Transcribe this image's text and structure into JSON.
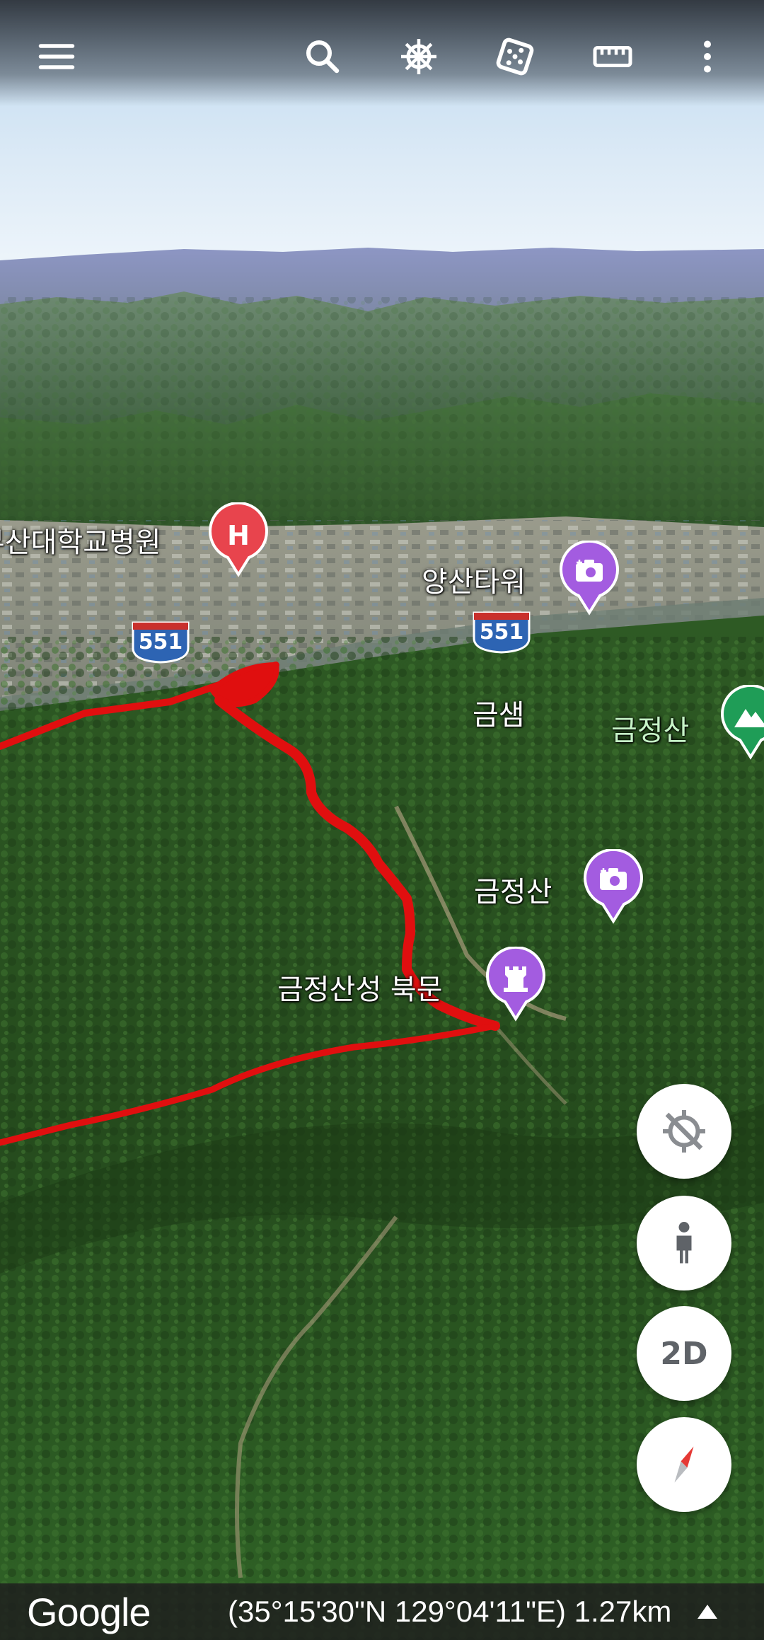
{
  "toolbar": {
    "menu_icon": "menu-icon",
    "search_icon": "search-icon",
    "voyager_icon": "ship-wheel-icon",
    "feeling_lucky_icon": "dice-icon",
    "measure_icon": "ruler-icon",
    "more_icon": "more-vert-icon"
  },
  "map": {
    "labels": {
      "hospital": "부산대학교병원",
      "yangsan_tower": "양산타워",
      "geumsaem": "금샘",
      "geumjeongsan_peak": "금정산",
      "geumjeongsan_photo": "금정산",
      "north_gate": "금정산성 북문"
    },
    "route_shields": [
      "551",
      "551"
    ],
    "pins": {
      "hospital": "hospital-pin-icon",
      "yangsan_tower": "photo-pin-icon",
      "geumjeongsan_peak": "mountain-pin-icon",
      "geumjeongsan_photo": "photo-pin-icon",
      "north_gate": "castle-pin-icon"
    },
    "colors": {
      "track": "#e00f0f",
      "hospital_pin": "#e8444d",
      "photo_pin": "#a35ce0",
      "mountain_pin": "#1f9d57"
    }
  },
  "controls": {
    "location_icon": "location-off-icon",
    "street_view_icon": "pegman-icon",
    "view_mode_label": "2D",
    "compass_icon": "compass-icon"
  },
  "status_bar": {
    "logo": "Google",
    "coordinates": "(35°15'30\"N 129°04'11\"E) 1.27km",
    "expand_icon": "triangle-up-icon"
  }
}
